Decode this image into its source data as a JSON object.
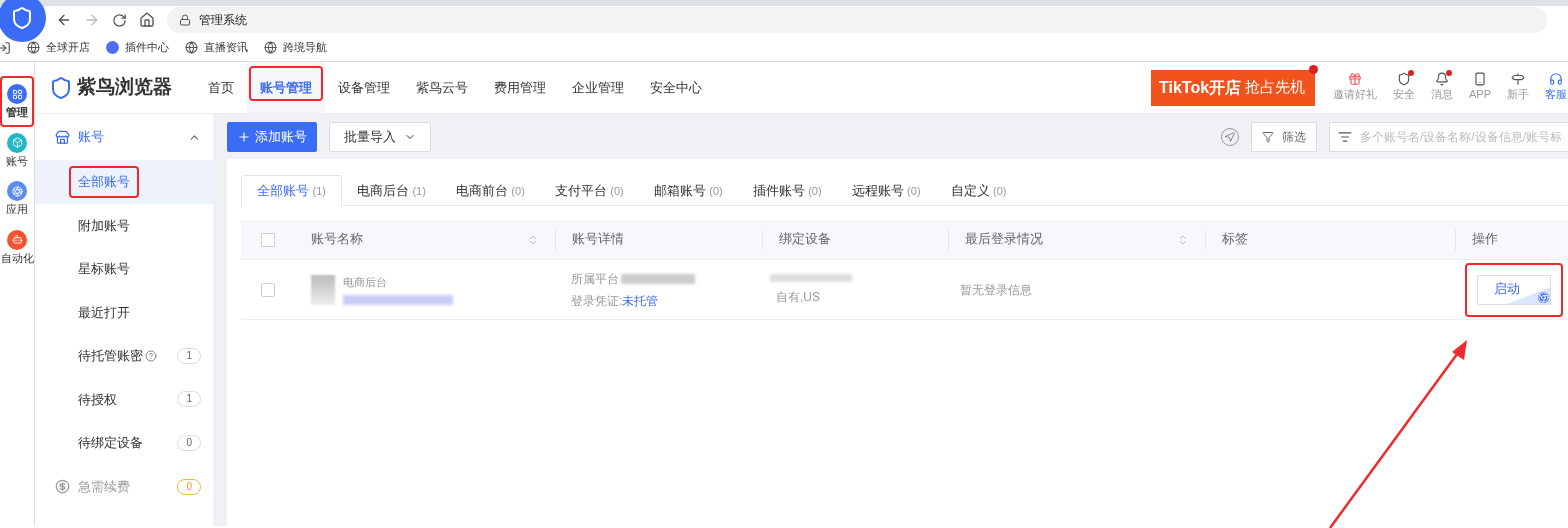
{
  "browser": {
    "title": "管理系统",
    "bookmarks": [
      {
        "label": "全球开店",
        "kind": "globe"
      },
      {
        "label": "插件中心",
        "kind": "plugin"
      },
      {
        "label": "直播资讯",
        "kind": "globe"
      },
      {
        "label": "跨境导航",
        "kind": "globe"
      }
    ]
  },
  "rail": [
    {
      "label": "管理",
      "selected": true,
      "highlighted": true,
      "color": "#3b6cf6"
    },
    {
      "label": "账号",
      "selected": false,
      "highlighted": false,
      "color": "#22b8c9"
    },
    {
      "label": "应用",
      "selected": false,
      "highlighted": false,
      "color": "#5b8def"
    },
    {
      "label": "自动化",
      "selected": false,
      "highlighted": false,
      "color": "#f2542d"
    }
  ],
  "brand": "紫鸟浏览器",
  "nav": [
    {
      "label": "首页",
      "selected": false,
      "highlighted": false
    },
    {
      "label": "账号管理",
      "selected": true,
      "highlighted": true
    },
    {
      "label": "设备管理",
      "selected": false,
      "highlighted": false
    },
    {
      "label": "紫鸟云号",
      "selected": false,
      "highlighted": false
    },
    {
      "label": "费用管理",
      "selected": false,
      "highlighted": false
    },
    {
      "label": "企业管理",
      "selected": false,
      "highlighted": false
    },
    {
      "label": "安全中心",
      "selected": false,
      "highlighted": false
    }
  ],
  "promo": {
    "text": "TikTok开店",
    "sub": "抢占先机"
  },
  "header_actions": [
    {
      "label": "邀请好礼",
      "kind": "gift",
      "dot": false,
      "selected": false
    },
    {
      "label": "安全",
      "kind": "shield",
      "dot": true,
      "selected": false
    },
    {
      "label": "消息",
      "kind": "bell",
      "dot": true,
      "selected": false
    },
    {
      "label": "APP",
      "kind": "phone",
      "dot": false,
      "selected": false
    },
    {
      "label": "新手",
      "kind": "signpost",
      "dot": false,
      "selected": false
    },
    {
      "label": "客服",
      "kind": "headset",
      "dot": false,
      "selected": true
    }
  ],
  "sidebar": {
    "group": {
      "label": "账号",
      "expanded": true
    },
    "items": [
      {
        "label": "全部账号",
        "selected": true,
        "highlighted": true
      },
      {
        "label": "附加账号",
        "selected": false,
        "highlighted": false
      },
      {
        "label": "星标账号",
        "selected": false,
        "highlighted": false
      },
      {
        "label": "最近打开",
        "selected": false,
        "highlighted": false
      },
      {
        "label": "待托管账密",
        "selected": false,
        "highlighted": false,
        "help": true,
        "count": "1"
      },
      {
        "label": "待授权",
        "selected": false,
        "highlighted": false,
        "count": "1"
      },
      {
        "label": "待绑定设备",
        "selected": false,
        "highlighted": false,
        "count": "0"
      }
    ],
    "renew": {
      "label": "急需续费",
      "count": "0"
    }
  },
  "toolbar": {
    "add": "添加账号",
    "import": "批量导入",
    "filter": "筛选",
    "search_placeholder": "多个账号名/设备名称/设备信息/账号标"
  },
  "tabs": [
    {
      "label": "全部账号",
      "count": "(1)",
      "selected": true
    },
    {
      "label": "电商后台",
      "count": "(1)",
      "selected": false
    },
    {
      "label": "电商前台",
      "count": "(0)",
      "selected": false
    },
    {
      "label": "支付平台",
      "count": "(0)",
      "selected": false
    },
    {
      "label": "邮箱账号",
      "count": "(0)",
      "selected": false
    },
    {
      "label": "插件账号",
      "count": "(0)",
      "selected": false
    },
    {
      "label": "远程账号",
      "count": "(0)",
      "selected": false
    },
    {
      "label": "自定义",
      "count": "(0)",
      "selected": false
    }
  ],
  "table": {
    "select_all_checked": false,
    "columns": [
      {
        "label": "账号名称",
        "sortable": true
      },
      {
        "label": "账号详情",
        "sortable": false
      },
      {
        "label": "绑定设备",
        "sortable": false
      },
      {
        "label": "最后登录情况",
        "sortable": true
      },
      {
        "label": "标签",
        "sortable": false
      },
      {
        "label": "操作",
        "sortable": false
      }
    ],
    "rows": [
      {
        "checked": false,
        "type": "电商后台",
        "platform_label": "所属平台",
        "credential_label": "登录凭证:",
        "credential_value": "未托管",
        "device": "自有,US",
        "last_login": "暂无登录信息",
        "action": "启动",
        "highlighted": true
      }
    ]
  },
  "annotation_arrow": true
}
